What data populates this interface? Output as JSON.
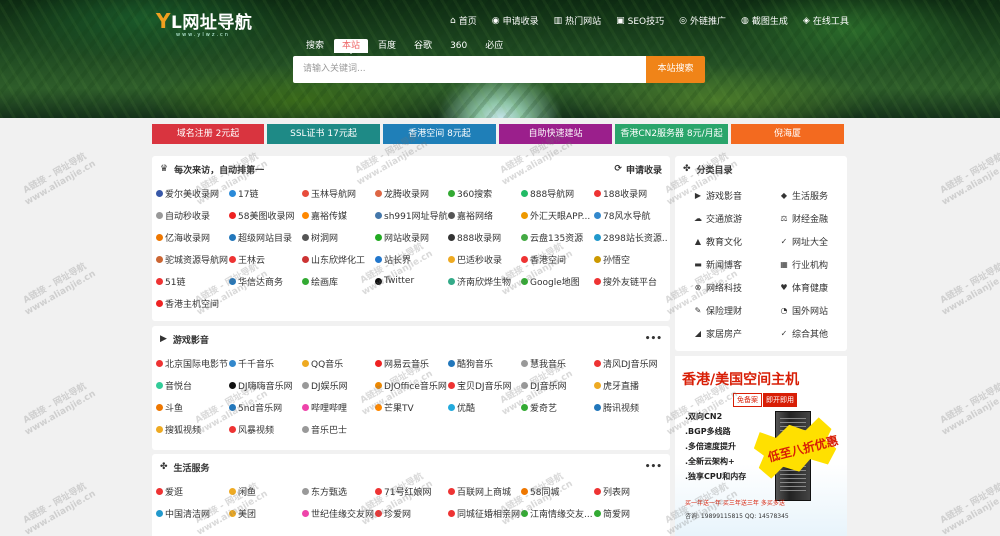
{
  "logo": {
    "text_a": "Y",
    "text_b": "L网址导航",
    "sub": "www.ylwz.cn"
  },
  "nav": [
    {
      "icon": "home-icon",
      "glyph": "⌂",
      "label": "首页"
    },
    {
      "icon": "submit-icon",
      "glyph": "◉",
      "label": "申请收录"
    },
    {
      "icon": "chart-icon",
      "glyph": "▥",
      "label": "热门网站"
    },
    {
      "icon": "seo-icon",
      "glyph": "▣",
      "label": "SEO技巧"
    },
    {
      "icon": "external-link-icon",
      "glyph": "◎",
      "label": "外链推广"
    },
    {
      "icon": "screenshot-icon",
      "glyph": "◍",
      "label": "截图生成"
    },
    {
      "icon": "tools-icon",
      "glyph": "◈",
      "label": "在线工具"
    }
  ],
  "search": {
    "tabs": [
      "搜索",
      "本站",
      "百度",
      "谷歌",
      "360",
      "必应"
    ],
    "active_tab": 1,
    "placeholder": "请输入关键词...",
    "button": "本站搜索"
  },
  "banners": [
    {
      "label": "域名注册 2元起",
      "color": "#d9343f",
      "w": 112
    },
    {
      "label": "SSL证书 17元起",
      "color": "#1e8a86",
      "w": 113
    },
    {
      "label": "香港空间 8元起",
      "color": "#1f7fb8",
      "w": 113
    },
    {
      "label": "自助快速建站",
      "color": "#9b1f8c",
      "w": 113
    },
    {
      "label": "香港CN2服务器 8元/月起",
      "color": "#2aa56b",
      "w": 113
    },
    {
      "label": "倪海厦",
      "color": "#f36a1f",
      "w": 113
    }
  ],
  "recent": {
    "title": "每次来访，自动排第一",
    "apply": "申请收录",
    "items": [
      [
        "爱尔美收录网",
        "#3858a8"
      ],
      [
        "17链",
        "#2a8ad8"
      ],
      [
        "玉林导航网",
        "#e74c3c"
      ],
      [
        "龙腾收录网",
        "#d64"
      ],
      [
        "360搜索",
        "#3a3"
      ],
      [
        "888导航网",
        "#2b6"
      ],
      [
        "188收录网",
        "#e33"
      ],
      [
        "自动秒收录",
        "#999"
      ],
      [
        "58美图收录网",
        "#e22"
      ],
      [
        "嘉裕传媒",
        "#f80"
      ],
      [
        "sh991网址导航",
        "#47a"
      ],
      [
        "嘉裕网络",
        "#555"
      ],
      [
        "外汇天眼APP...",
        "#e90"
      ],
      [
        "78风水导航",
        "#38c"
      ],
      [
        "亿海收录网",
        "#e70"
      ],
      [
        "超级网站目录",
        "#27b"
      ],
      [
        "树洞网",
        "#555"
      ],
      [
        "网站收录网",
        "#2a2"
      ],
      [
        "888收录网",
        "#333"
      ],
      [
        "云盘135资源",
        "#4a4"
      ],
      [
        "2898站长资源...",
        "#29c"
      ],
      [
        "驼城资源导航网",
        "#c63"
      ],
      [
        "王林云",
        "#e33"
      ],
      [
        "山东欣烨化工",
        "#c33"
      ],
      [
        "站长界",
        "#27c"
      ],
      [
        "巴适秒收录",
        "#ea2"
      ],
      [
        "香港空间",
        "#e33"
      ],
      [
        "孙悟空",
        "#c90"
      ],
      [
        "51链",
        "#e33"
      ],
      [
        "华信达商务",
        "#27b"
      ],
      [
        "绘画库",
        "#3a3"
      ],
      [
        "Twitter",
        "#111"
      ],
      [
        "济南欣烨生物",
        "#3a8"
      ],
      [
        "Google地图",
        "#3a3"
      ],
      [
        "搜外友链平台",
        "#e33"
      ],
      [
        "香港主机空间",
        "#e22"
      ]
    ]
  },
  "ent": {
    "title": "游戏影音",
    "items": [
      [
        "北京国际电影节",
        "#e33"
      ],
      [
        "千千音乐",
        "#38c"
      ],
      [
        "QQ音乐",
        "#ea2"
      ],
      [
        "网易云音乐",
        "#e22"
      ],
      [
        "酷狗音乐",
        "#27b"
      ],
      [
        "慧我音乐",
        "#999"
      ],
      [
        "清风DJ音乐网",
        "#e33"
      ],
      [
        "音悦台",
        "#3c9"
      ],
      [
        "DJ嗨嗨音乐网",
        "#111"
      ],
      [
        "DJ娱乐网",
        "#999"
      ],
      [
        "DJOffice音乐网",
        "#e80"
      ],
      [
        "宝贝DJ音乐网",
        "#e33"
      ],
      [
        "DJ音乐网",
        "#999"
      ],
      [
        "虎牙直播",
        "#ea2"
      ],
      [
        "斗鱼",
        "#e70"
      ],
      [
        "5nd音乐网",
        "#27b"
      ],
      [
        "哔哩哔哩",
        "#e4a"
      ],
      [
        "芒果TV",
        "#f80"
      ],
      [
        "优酷",
        "#2ad"
      ],
      [
        "爱奇艺",
        "#3a3"
      ],
      [
        "腾讯视频",
        "#27b"
      ],
      [
        "搜狐视频",
        "#ea2"
      ],
      [
        "风暴视频",
        "#e33"
      ],
      [
        "音乐巴士",
        "#999"
      ]
    ]
  },
  "life": {
    "title": "生活服务",
    "items": [
      [
        "爱逛",
        "#e33"
      ],
      [
        "闲鱼",
        "#ea2"
      ],
      [
        "东方甄选",
        "#999"
      ],
      [
        "71号红娘网",
        "#e33"
      ],
      [
        "百联网上商城",
        "#e33"
      ],
      [
        "58同城",
        "#e70"
      ],
      [
        "列表网",
        "#e33"
      ],
      [
        "中国清洁网",
        "#29c"
      ],
      [
        "美团",
        "#ea2"
      ],
      [
        "世纪佳缘交友网",
        "#e4a"
      ],
      [
        "珍爱网",
        "#e33"
      ],
      [
        "同城征婚相亲网",
        "#e33"
      ],
      [
        "江南情缘交友...",
        "#3a3"
      ],
      [
        "简爱网",
        "#3a3"
      ]
    ]
  },
  "categories": {
    "title": "分类目录",
    "items": [
      [
        "video-icon",
        "▶",
        "游戏影音"
      ],
      [
        "services-icon",
        "◆",
        "生活服务"
      ],
      [
        "travel-icon",
        "☁",
        "交通旅游"
      ],
      [
        "finance-icon",
        "⚖",
        "财经金融"
      ],
      [
        "education-icon",
        "▲",
        "教育文化"
      ],
      [
        "web-icon",
        "✓",
        "网址大全"
      ],
      [
        "news-icon",
        "▬",
        "新闻博客"
      ],
      [
        "industry-icon",
        "▦",
        "行业机构"
      ],
      [
        "tech-icon",
        "⊗",
        "网络科技"
      ],
      [
        "health-icon",
        "♥",
        "体育健康"
      ],
      [
        "insurance-icon",
        "✎",
        "保险理财"
      ],
      [
        "foreign-icon",
        "◔",
        "国外网站"
      ],
      [
        "home-icon",
        "◢",
        "家居房产"
      ],
      [
        "misc-icon",
        "✓",
        "综合其他"
      ]
    ]
  },
  "ad": {
    "title": "香港/美国空间主机",
    "tag1": "免备案",
    "tag2": "即开即用",
    "lines": [
      ".双向CN2",
      ".BGP多线路",
      ".多倍速度提升",
      ".全新云架构+",
      ".独享CPU和内存"
    ],
    "burst": "低至八折优惠",
    "bottom": "买一年送一年  买三年送三年  多买多送",
    "tel": "咨询: 19899115815  QQ: 14578345"
  },
  "watermark": {
    "line1": "A链接 - 网址导航",
    "line2": "www.alianjie.cn"
  }
}
